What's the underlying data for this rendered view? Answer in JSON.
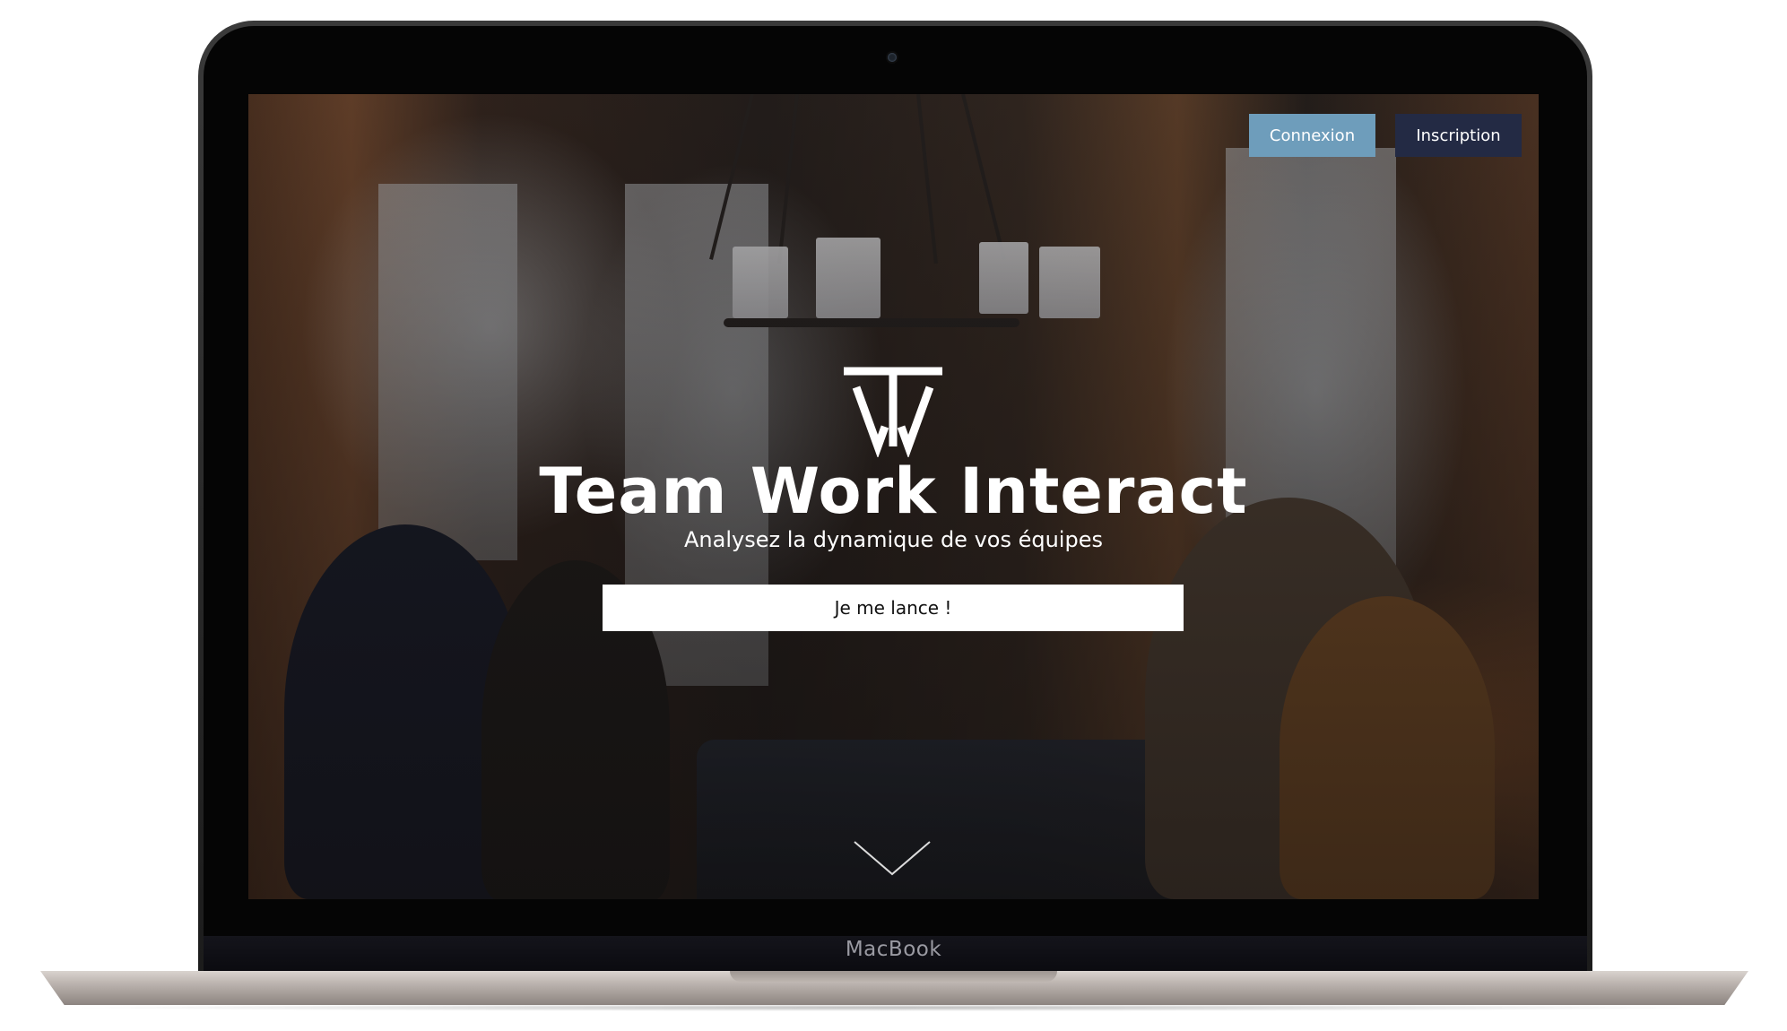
{
  "device": {
    "brand_label": "MacBook"
  },
  "header": {
    "login_label": "Connexion",
    "signup_label": "Inscription"
  },
  "hero": {
    "logo_icon": "tw-logo-icon",
    "title": "Team Work Interact",
    "subtitle": "Analysez la dynamique de vos équipes",
    "cta_label": "Je me lance !",
    "scroll_icon": "chevron-down-icon"
  },
  "colors": {
    "login_button_bg": "#6e9dbb",
    "signup_button_bg": "#232a44",
    "cta_bg": "#ffffff",
    "text_on_hero": "#ffffff"
  }
}
